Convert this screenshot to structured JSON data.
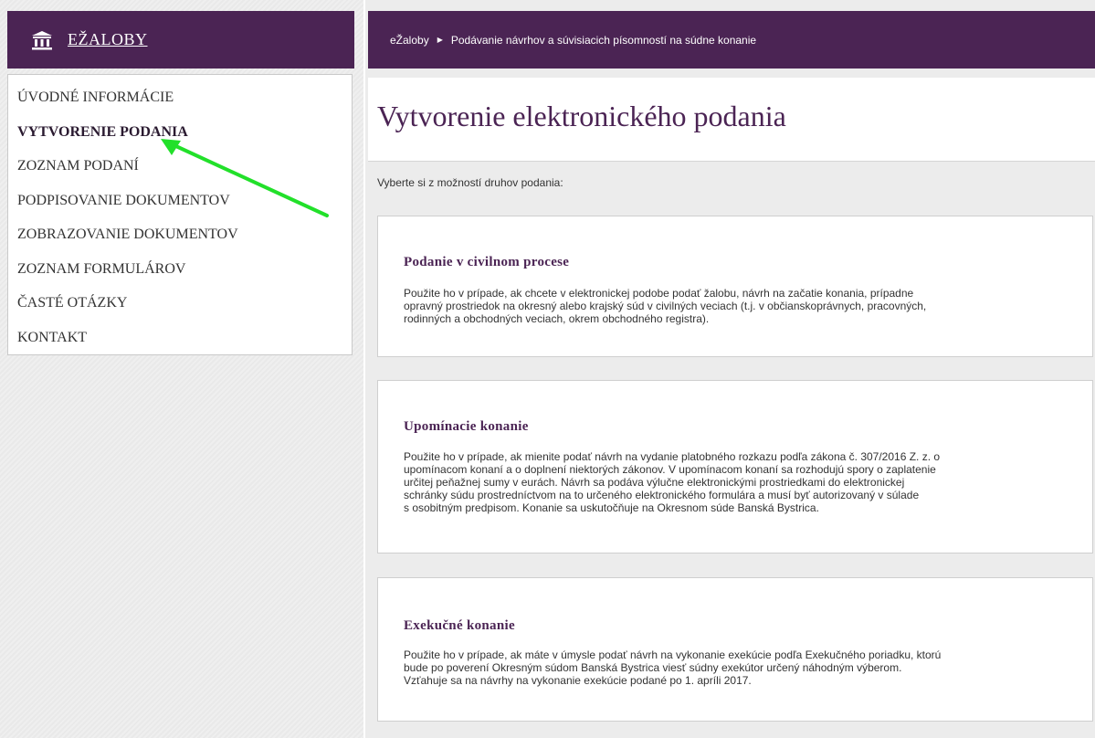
{
  "app": {
    "logo_text": "EŽALOBY",
    "logo_icon": "building-icon"
  },
  "sidebar": {
    "items": [
      {
        "label": "ÚVODNÉ INFORMÁCIE",
        "active": false
      },
      {
        "label": "VYTVORENIE PODANIA",
        "active": true
      },
      {
        "label": "ZOZNAM PODANÍ",
        "active": false
      },
      {
        "label": "PODPISOVANIE DOKUMENTOV",
        "active": false
      },
      {
        "label": "ZOBRAZOVANIE DOKUMENTOV",
        "active": false
      },
      {
        "label": "ZOZNAM FORMULÁROV",
        "active": false
      },
      {
        "label": "ČASTÉ OTÁZKY",
        "active": false
      },
      {
        "label": "KONTAKT",
        "active": false
      }
    ]
  },
  "breadcrumb": {
    "home": "eŽaloby",
    "separator_icon": "triangle-right-icon",
    "current": "Podávanie návrhov a súvisiacich písomností na súdne konanie"
  },
  "page": {
    "title": "Vytvorenie elektronického podania",
    "intro": "Vyberte si z možností druhov podania:"
  },
  "cards": [
    {
      "title": "Podanie v civilnom procese",
      "lines": [
        "Použite ho v prípade, ak chcete v elektronickej podobe podať žalobu, návrh na začatie konania, prípadne",
        "opravný prostriedok na okresný alebo krajský súd v civilných veciach (t.j. v občianskoprávnych, pracovných,",
        "rodinných a obchodných veciach, okrem obchodného registra)."
      ]
    },
    {
      "title": "Upomínacie konanie",
      "lines": [
        "Použite ho v prípade, ak mienite podať návrh na vydanie platobného rozkazu podľa zákona č. 307/2016 Z. z. o",
        "upomínacom konaní a o doplnení niektorých zákonov. V upomínacom konaní sa rozhodujú spory o zaplatenie",
        "určitej peňažnej sumy v eurách. Návrh sa podáva výlučne elektronickými prostriedkami do elektronickej",
        "schránky súdu prostredníctvom na to určeného elektronického formulára a musí byť autorizovaný v súlade",
        "s osobitným predpisom. Konanie sa uskutočňuje na Okresnom súde Banská Bystrica."
      ]
    },
    {
      "title": "Exekučné konanie",
      "lines": [
        "Použite ho v prípade, ak máte v úmysle podať návrh na vykonanie exekúcie podľa Exekučného poriadku, ktorú",
        "bude po poverení Okresným súdom Banská Bystrica viesť súdny exekútor určený náhodným výberom.",
        "Vzťahuje sa na návrhy na vykonanie exekúcie podané po 1. apríli 2017."
      ]
    }
  ],
  "annotation": {
    "arrow_color": "#22e02a"
  },
  "colors": {
    "brand": "#4b2454",
    "background": "#ececec"
  }
}
